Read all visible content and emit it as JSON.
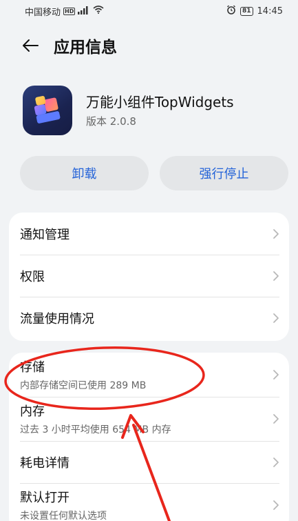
{
  "status_bar": {
    "carrier": "中国移动",
    "hd": "HD",
    "signal": "⁴ᴳ",
    "battery": "81",
    "time": "14:45"
  },
  "header": {
    "title": "应用信息"
  },
  "app": {
    "name": "万能小组件TopWidgets",
    "version": "版本 2.0.8"
  },
  "buttons": {
    "uninstall": "卸载",
    "force_stop": "强行停止"
  },
  "card1": {
    "items": [
      {
        "title": "通知管理"
      },
      {
        "title": "权限"
      },
      {
        "title": "流量使用情况"
      }
    ]
  },
  "card2": {
    "items": [
      {
        "title": "存储",
        "subtitle": "内部存储空间已使用 289 MB"
      },
      {
        "title": "内存",
        "subtitle": "过去 3 小时平均使用 654 MB 内存"
      },
      {
        "title": "耗电详情"
      },
      {
        "title": "默认打开",
        "subtitle": "未设置任何默认选项"
      }
    ]
  },
  "colors": {
    "accent": "#2463d8",
    "background": "#f1f3f5",
    "annotation": "#e8261c"
  }
}
